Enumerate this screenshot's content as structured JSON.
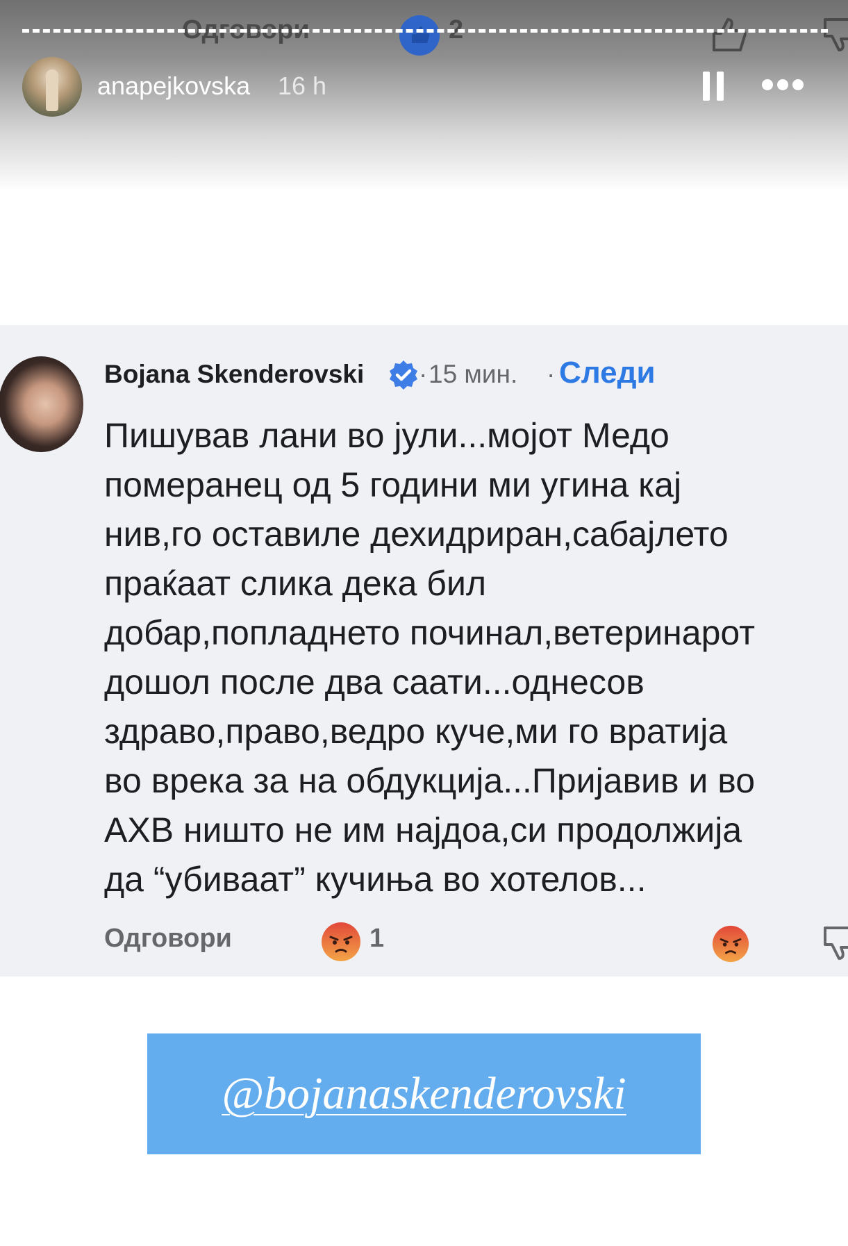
{
  "background_peek": {
    "reply_label": "Одговори",
    "like_count": "2"
  },
  "story": {
    "author": "anapejkovska",
    "age": "16 h"
  },
  "comment": {
    "commenter": "Bojana Skenderovski",
    "time": "15 мин.",
    "separator": "·",
    "follow_label": "Следи",
    "text": "Пишував лани во јули...мојот Медо\nпомеранец од 5 години ми угина кај\nнив,го оставиле дехидриран,сабајлето\nпраќаат слика дека бил\nдобар,попладнето починал,ветеринарот\nдошол после два саати...однесов\nздраво,право,ведро куче,ми го вратија\nво врека за на обдукција...Пријавив и во\nАХВ ништо не им најдоа,си продолжија\nда “убиваат” кучиња во хотелов...",
    "reply_label": "Одговори",
    "reaction_count": "1"
  },
  "mention": {
    "handle": "@bojanaskenderovski"
  },
  "colors": {
    "accent_blue": "#2d7ae4",
    "sticker_blue": "#63adef",
    "card_bg": "#f0f1f5",
    "angry_emoji": "#e0533c"
  }
}
